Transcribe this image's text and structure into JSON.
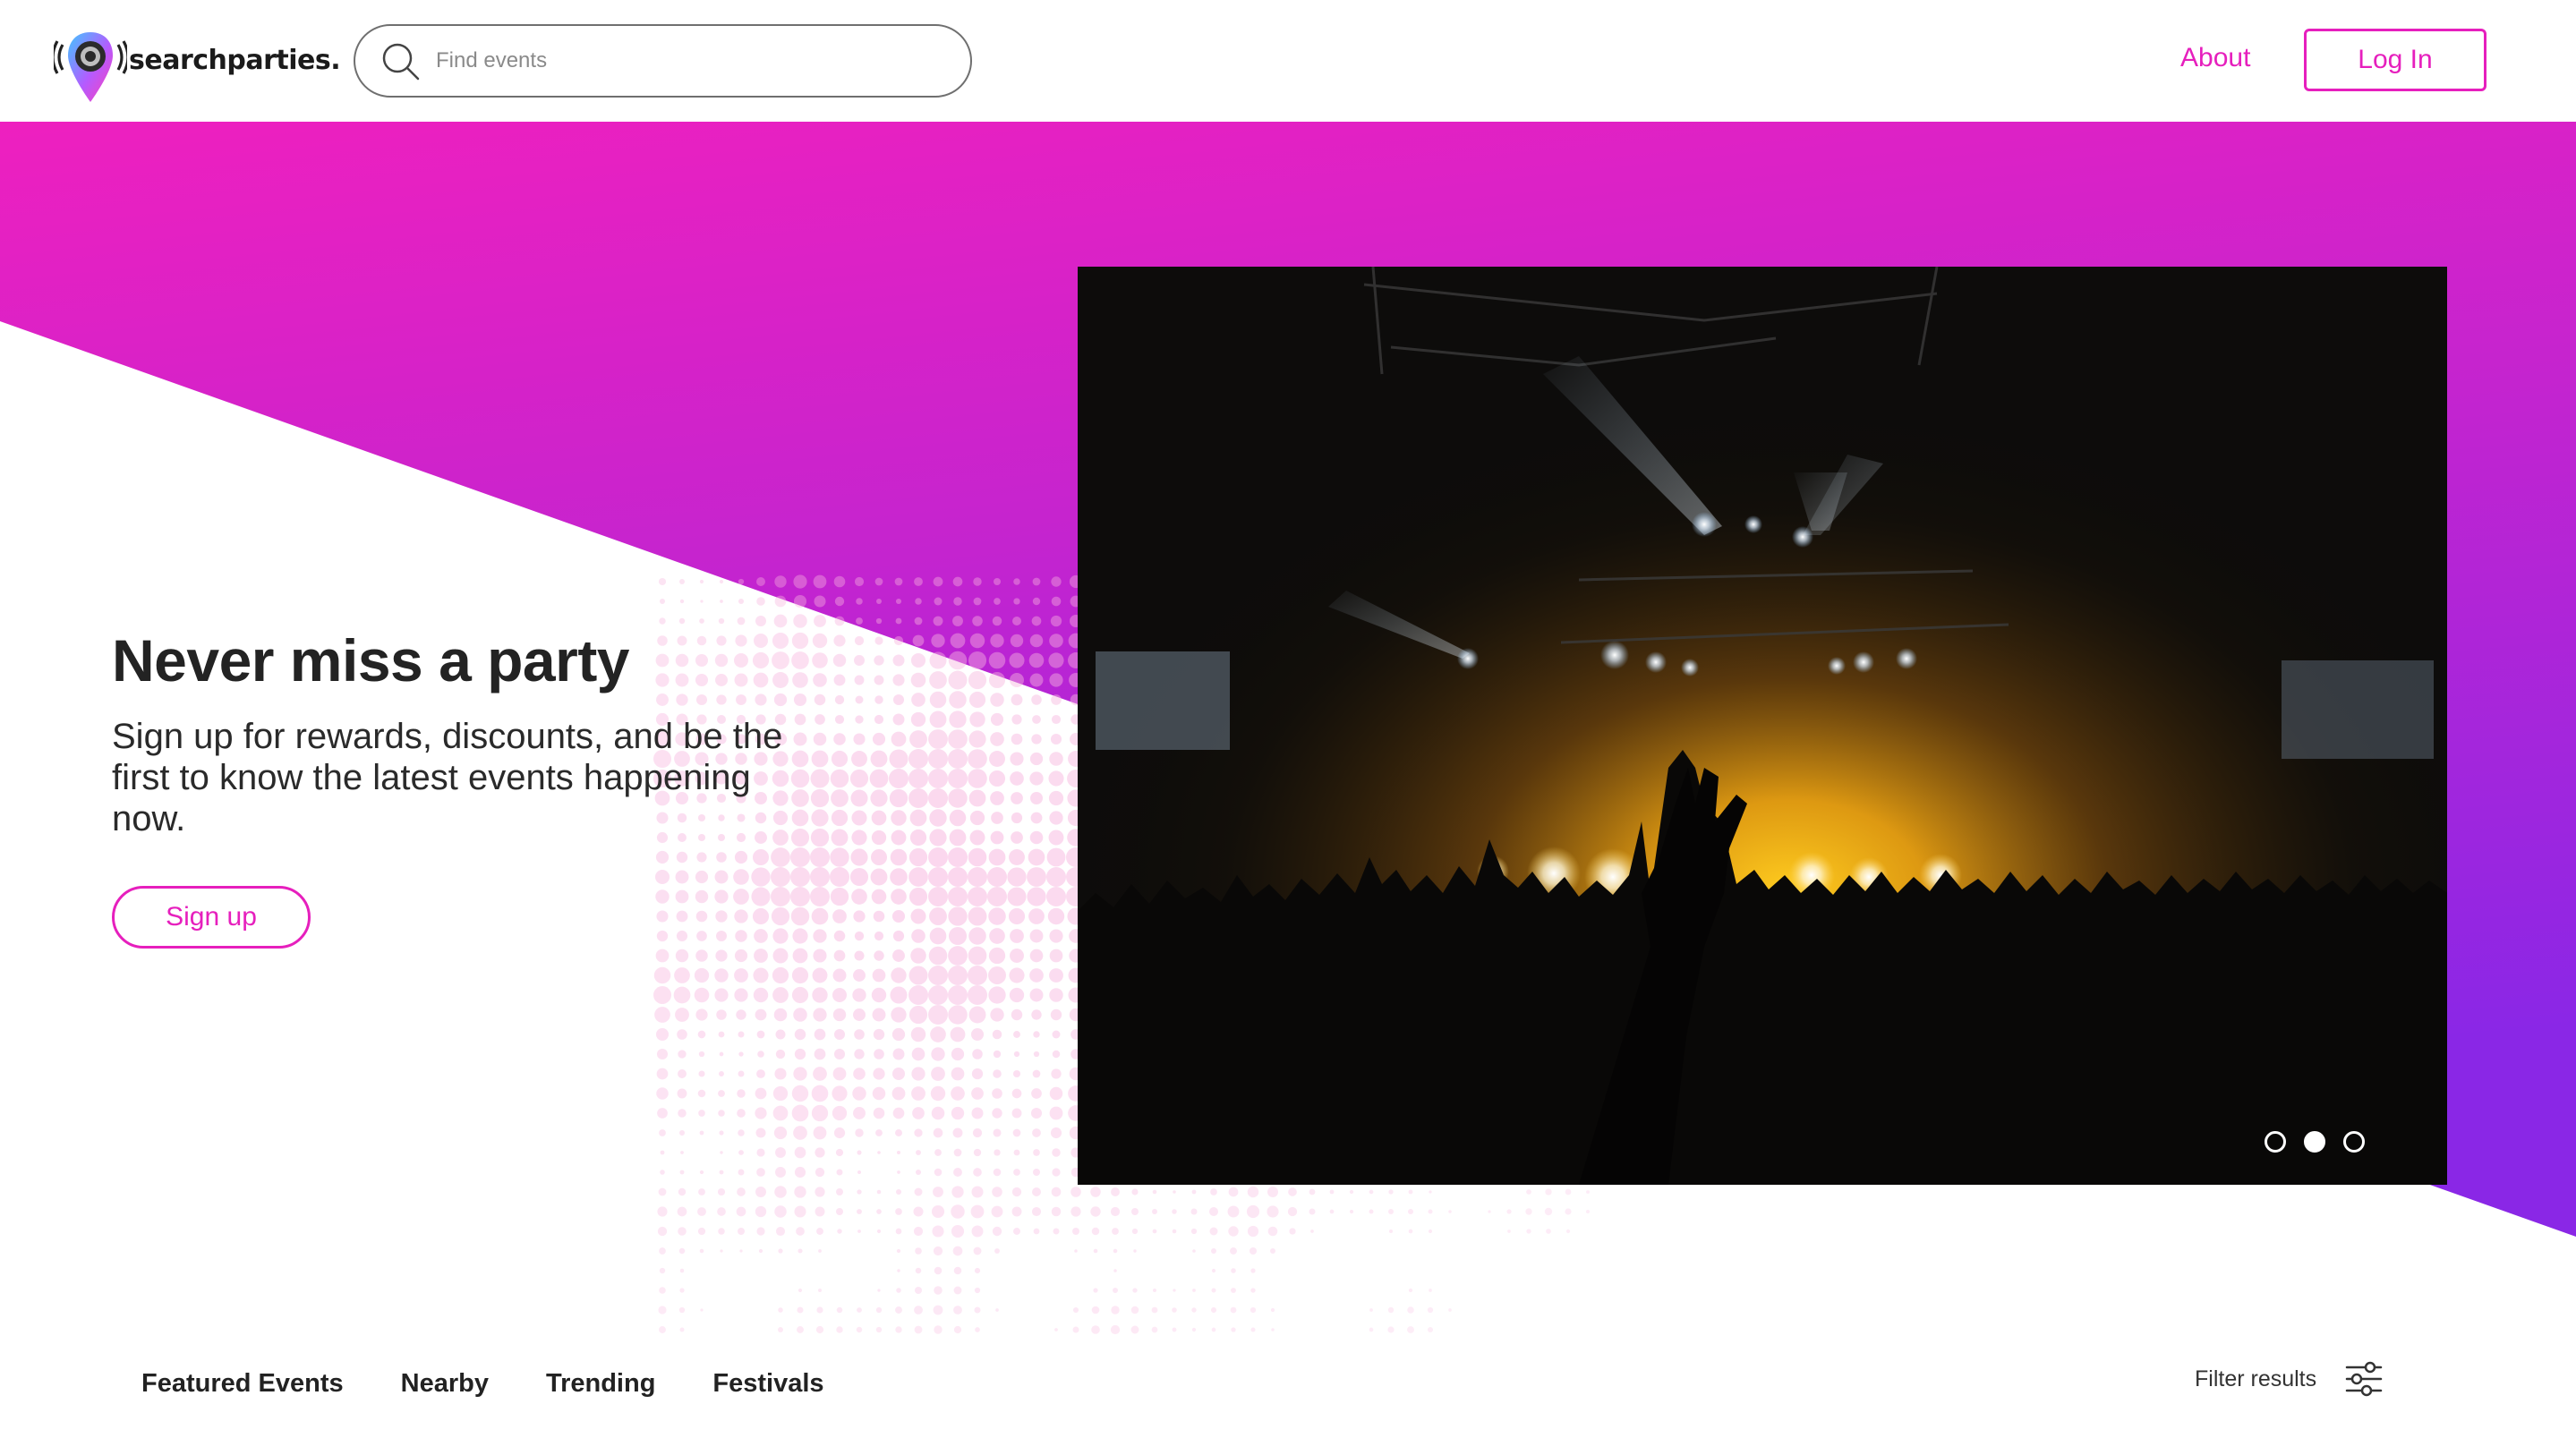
{
  "brand": {
    "name": "searchparties.",
    "accent": "#e61fbd",
    "gradient_end": "#8a27e6"
  },
  "header": {
    "search_placeholder": "Find events",
    "about_label": "About",
    "login_label": "Log In"
  },
  "hero": {
    "title": "Never miss a party",
    "subtitle": "Sign up for rewards, discounts, and be the first to know the latest events happening now.",
    "signup_label": "Sign up",
    "carousel": {
      "slides": 3,
      "active_index": 1
    }
  },
  "tabs": [
    "Featured Events",
    "Nearby",
    "Trending",
    "Festivals"
  ],
  "filter": {
    "label": "Filter results",
    "icon": "sliders-icon"
  }
}
